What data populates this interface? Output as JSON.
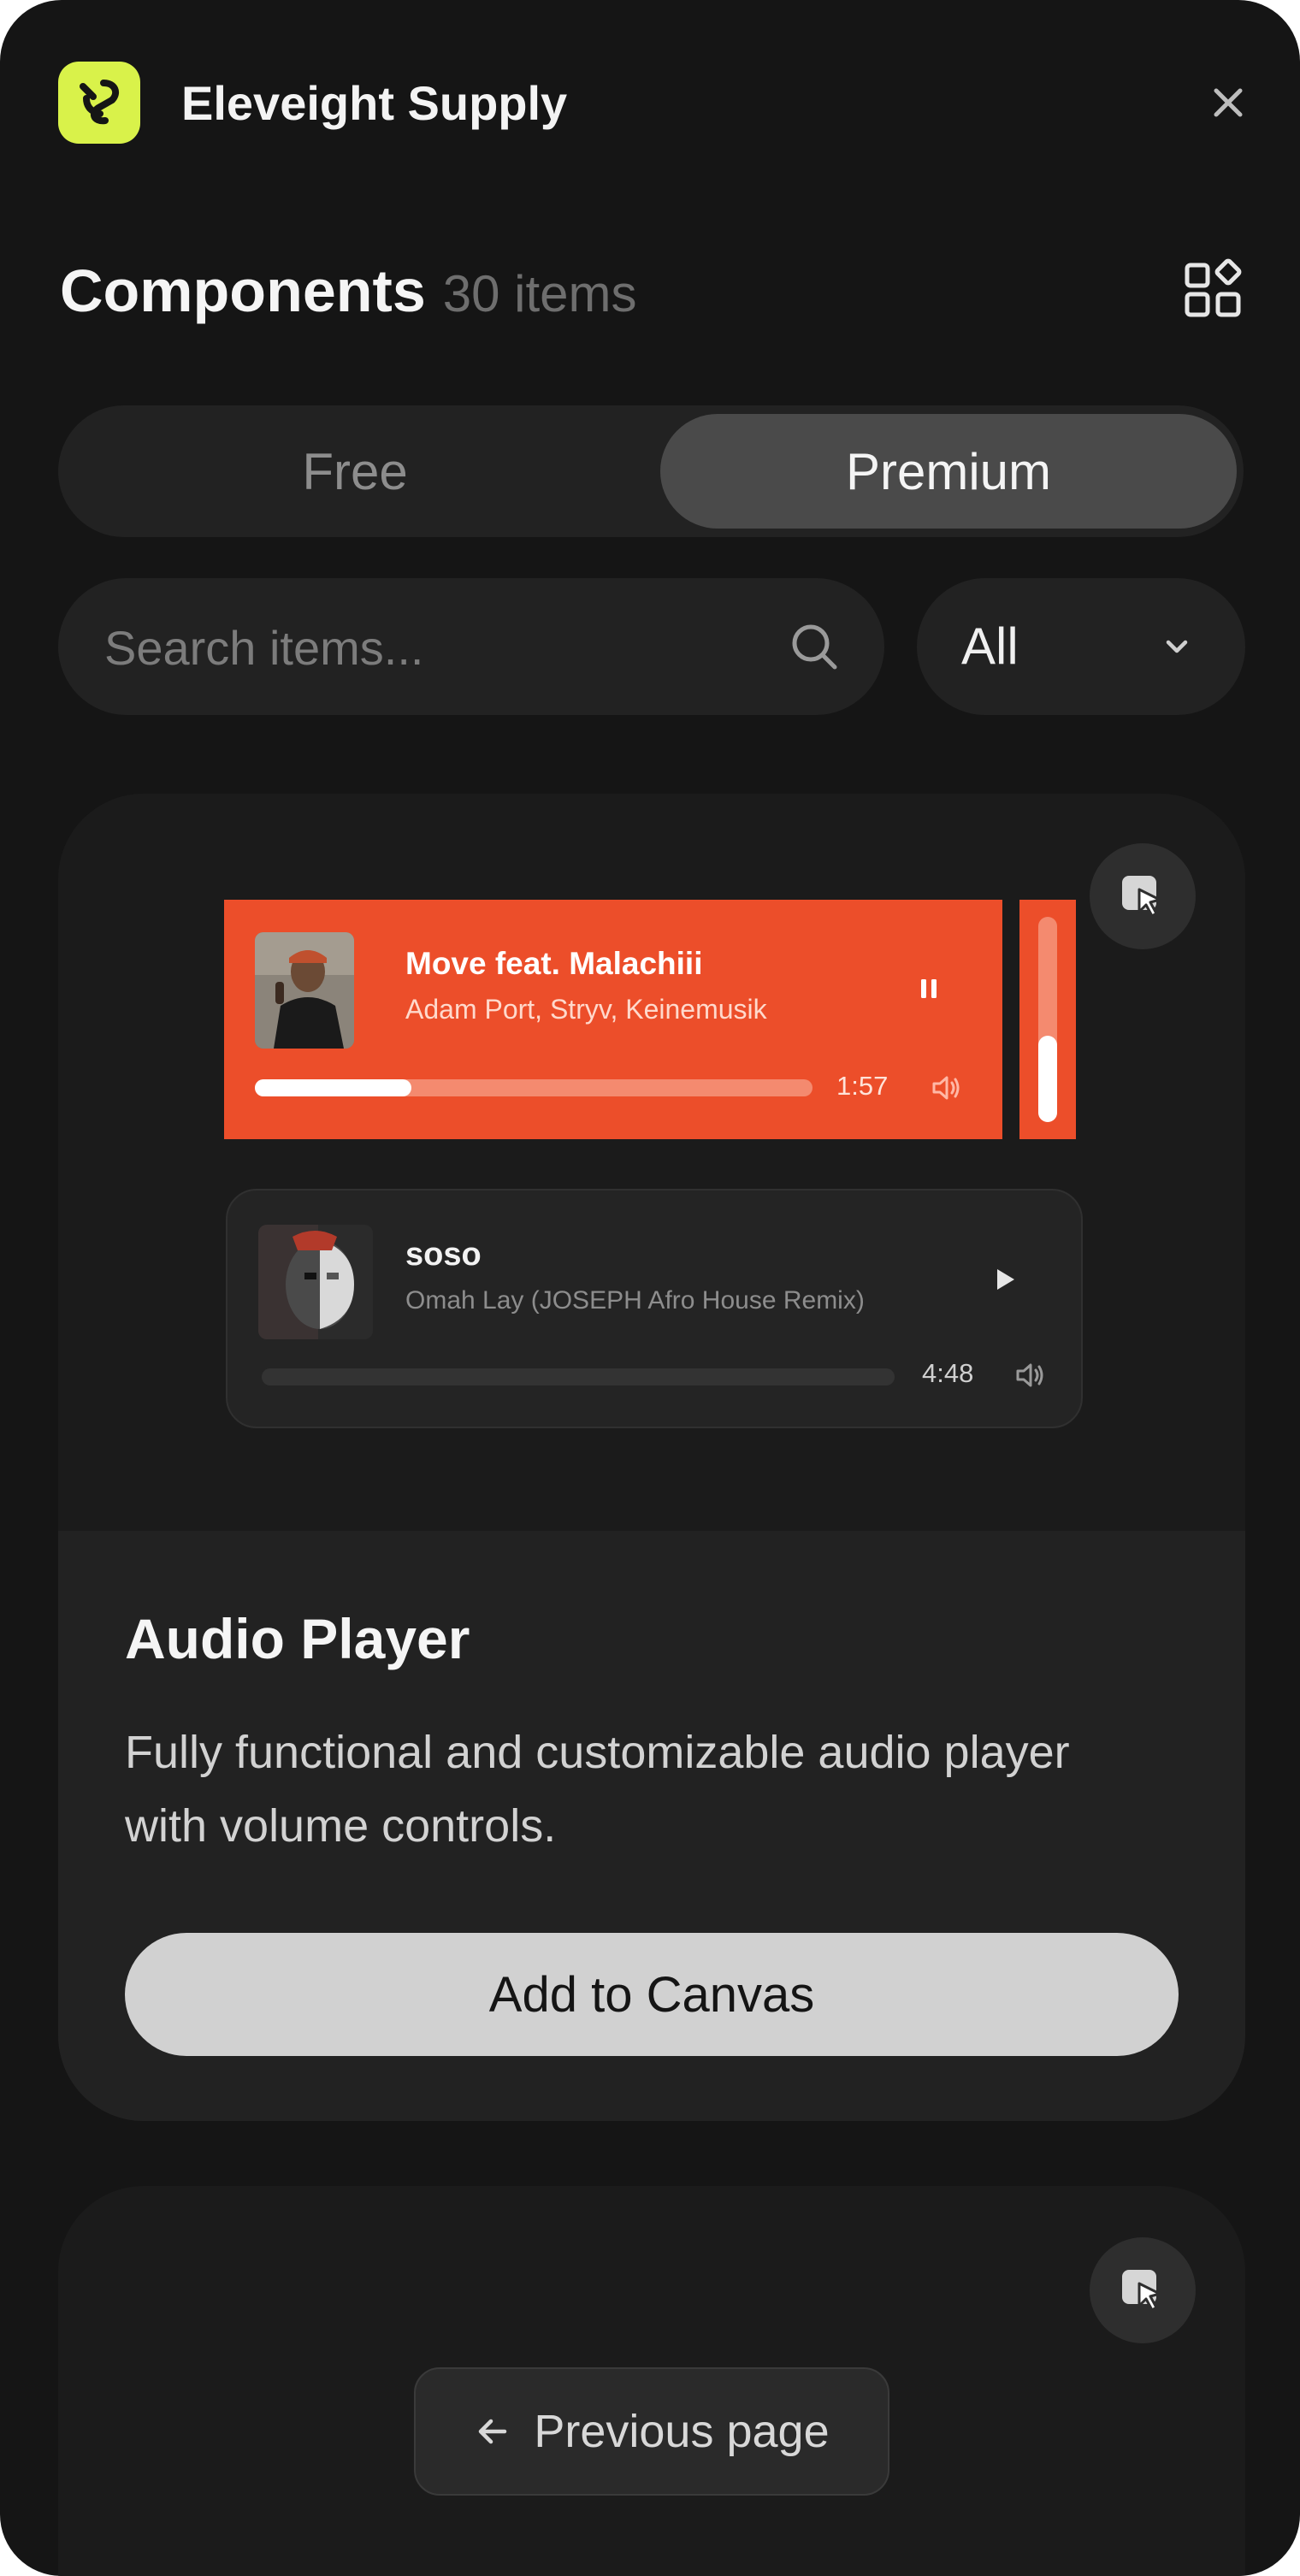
{
  "app": {
    "name": "Eleveight Supply"
  },
  "section": {
    "title": "Components",
    "count": "30 items"
  },
  "tabs": {
    "free": "Free",
    "premium": "Premium",
    "active": "Premium"
  },
  "search": {
    "placeholder": "Search items...",
    "value": ""
  },
  "filter": {
    "selected": "All"
  },
  "cards": [
    {
      "title": "Audio Player",
      "description": "Fully functional and customizable audio player with volume controls.",
      "button": "Add to Canvas",
      "preview": {
        "player_primary": {
          "title": "Move feat. Malachiii",
          "artist": "Adam Port, Stryv, Keinemusik",
          "time": "1:57",
          "state": "playing",
          "progress": 0.28,
          "volume": 0.42,
          "color": "#ec4e2a"
        },
        "player_secondary": {
          "title": "soso",
          "artist": "Omah Lay (JOSEPH Afro House Remix)",
          "time": "4:48",
          "state": "paused",
          "progress": 0,
          "color": "#242424"
        }
      }
    }
  ],
  "pagination": {
    "previous": "Previous page"
  },
  "icons": [
    "app-logo-icon",
    "close-icon",
    "grid-view-icon",
    "search-icon",
    "chevron-down-icon",
    "cursor-select-icon",
    "pause-icon",
    "play-icon",
    "volume-icon",
    "arrow-left-icon"
  ],
  "colors": {
    "accent": "#d9f24a",
    "background": "#151515",
    "surface": "#222222"
  }
}
